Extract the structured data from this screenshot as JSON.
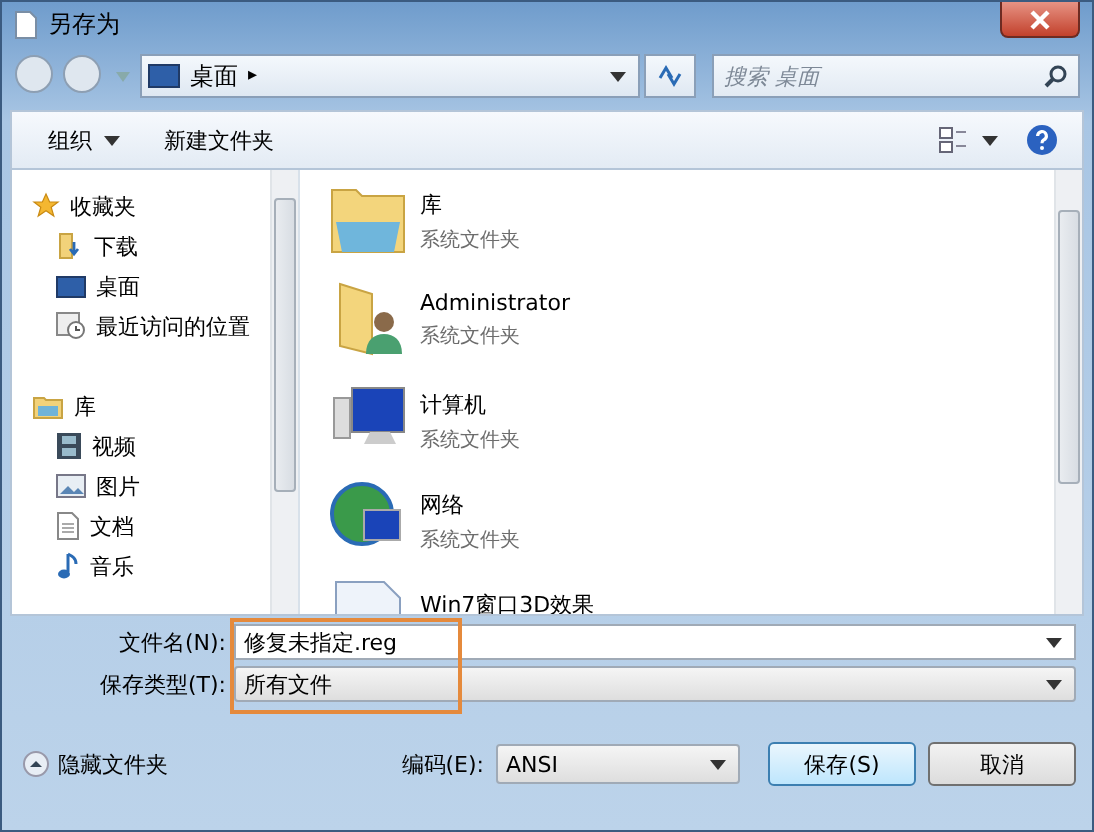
{
  "window": {
    "title": "另存为"
  },
  "address_bar": {
    "location": "桌面",
    "separator": "▸"
  },
  "search": {
    "placeholder": "搜索 桌面"
  },
  "toolbar": {
    "organize": "组织",
    "new_folder": "新建文件夹"
  },
  "sidebar": {
    "groups": [
      {
        "label": "收藏夹",
        "kind": "star",
        "children": [
          {
            "label": "下载",
            "kind": "download"
          },
          {
            "label": "桌面",
            "kind": "desktop"
          },
          {
            "label": "最近访问的位置",
            "kind": "recent"
          }
        ]
      },
      {
        "label": "库",
        "kind": "library",
        "children": [
          {
            "label": "视频",
            "kind": "video"
          },
          {
            "label": "图片",
            "kind": "picture"
          },
          {
            "label": "文档",
            "kind": "document"
          },
          {
            "label": "音乐",
            "kind": "music"
          }
        ]
      }
    ]
  },
  "items": [
    {
      "name": "库",
      "subtitle": "系统文件夹",
      "kind": "library"
    },
    {
      "name": "Administrator",
      "subtitle": "系统文件夹",
      "kind": "user"
    },
    {
      "name": "计算机",
      "subtitle": "系统文件夹",
      "kind": "computer"
    },
    {
      "name": "网络",
      "subtitle": "系统文件夹",
      "kind": "network"
    },
    {
      "name": "Win7窗口3D效果",
      "kind": "file"
    }
  ],
  "filename": {
    "label": "文件名(N):",
    "value": "修复未指定.reg"
  },
  "filetype": {
    "label": "保存类型(T):",
    "value": "所有文件"
  },
  "hide_folders": "隐藏文件夹",
  "encoding": {
    "label": "编码(E):",
    "value": "ANSI"
  },
  "buttons": [
    "保存(S)",
    "取消"
  ]
}
